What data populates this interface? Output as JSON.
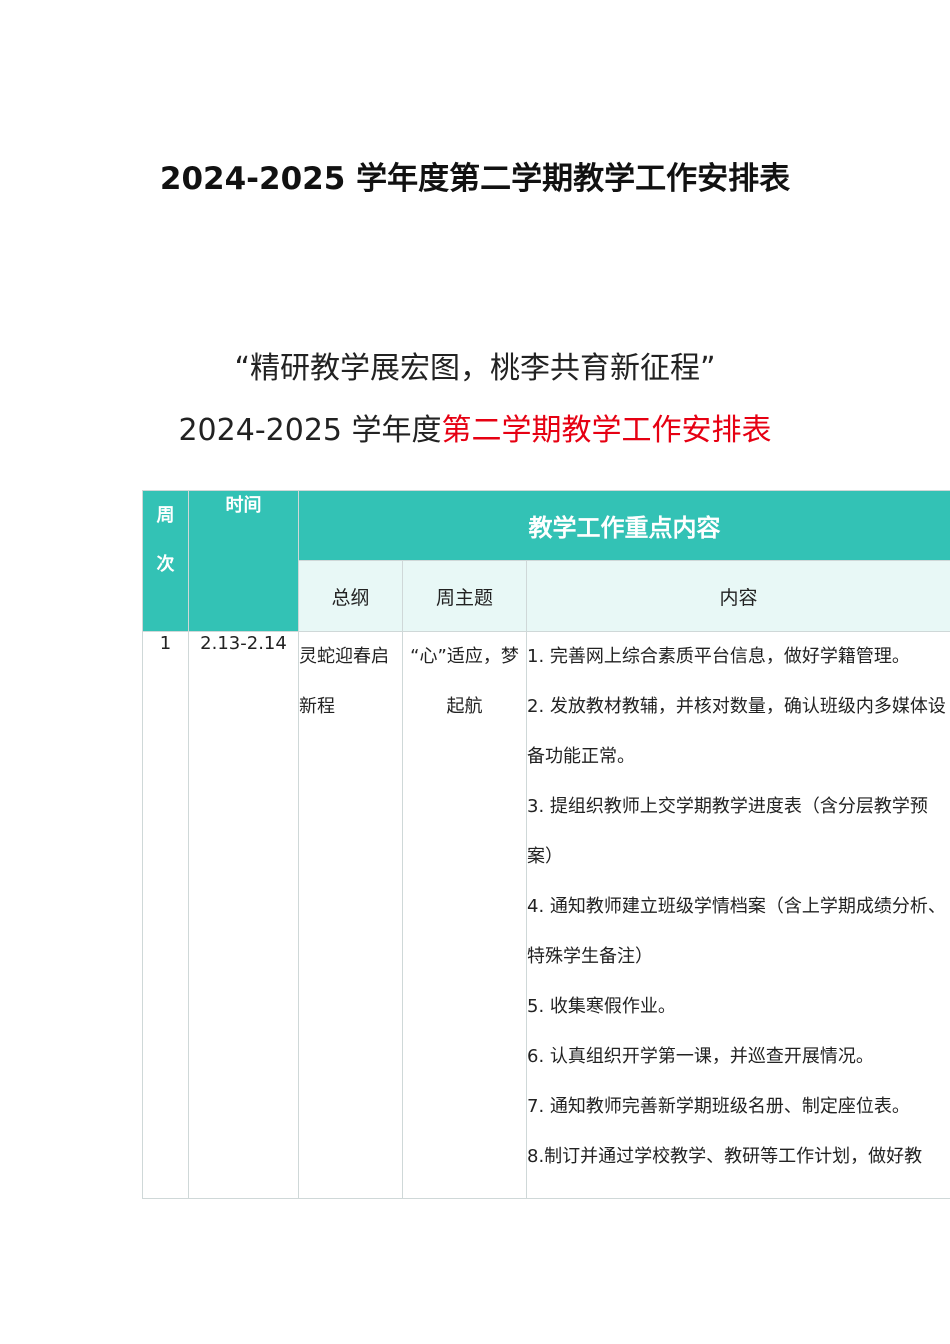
{
  "document": {
    "title": "2024-2025 学年度第二学期教学工作安排表",
    "slogan": "“精研教学展宏图，桃李共育新征程”",
    "subtitle_part1": "2024-2025 学年度",
    "subtitle_part2": "第二学期教学工作安排表"
  },
  "table": {
    "header": {
      "week_char1": "周",
      "week_char2": "次",
      "time": "时间",
      "main": "教学工作重点内容",
      "outline": "总纲",
      "theme": "周主题",
      "content": "内容"
    },
    "rows": [
      {
        "week": "1",
        "time": "2.13-2.14",
        "outline": "灵蛇迎春启新程",
        "theme": "“心”适应，梦起航",
        "items": [
          "1. 完善网上综合素质平台信息，做好学籍管理。",
          "2. 发放教材教辅，并核对数量，确认班级内多媒体设备功能正常。",
          "3. 提组织教师上交学期教学进度表（含分层教学预案）",
          "4. 通知教师建立班级学情档案（含上学期成绩分析、特殊学生备注）",
          "5. 收集寒假作业。",
          "6. 认真组织开学第一课，并巡查开展情况。",
          "7. 通知教师完善新学期班级名册、制定座位表。",
          "8.制订并通过学校教学、教研等工作计划，做好教"
        ]
      }
    ]
  },
  "colors": {
    "header_teal": "#33c2b5",
    "subheader_bg": "#e8f8f6",
    "highlight_red": "#e60012"
  }
}
